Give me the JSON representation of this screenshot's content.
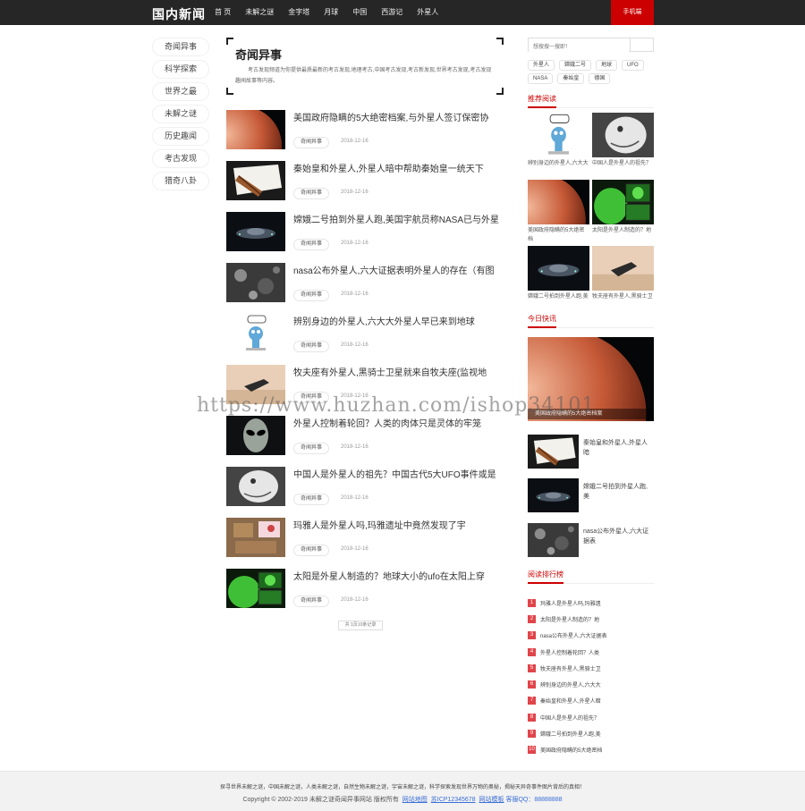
{
  "header": {
    "logo": "国内新闻",
    "nav": [
      "首 页",
      "未解之谜",
      "金字塔",
      "月球",
      "中国",
      "西游记",
      "外星人"
    ],
    "mobile": "手机端"
  },
  "leftnav": [
    "奇闻异事",
    "科学探索",
    "世界之最",
    "未解之谜",
    "历史趣闻",
    "考古发现",
    "猎奇八卦"
  ],
  "intro": {
    "title": "奇闻异事",
    "desc": "考古发现频道为你提供最质最新的考古发现,地理考古,中国考古发现,考古新发现,世界考古发现,考古发现趣闻故事等内容。"
  },
  "articles": [
    {
      "title": "美国政府隐瞒的5大绝密档案,与外星人签订保密协",
      "tag": "奇闻异事",
      "date": "2018-12-16",
      "thumb": "mars"
    },
    {
      "title": "秦始皇和外星人,外星人暗中帮助秦始皇一统天下",
      "tag": "奇闻异事",
      "date": "2018-12-16",
      "thumb": "paper"
    },
    {
      "title": "嫦娥二号拍到外星人跑,美国宇航员称NASA已与外星",
      "tag": "奇闻异事",
      "date": "2018-12-16",
      "thumb": "ship"
    },
    {
      "title": "nasa公布外星人,六大证据表明外星人的存在（有图",
      "tag": "奇闻异事",
      "date": "2018-12-16",
      "thumb": "moon"
    },
    {
      "title": "辨别身边的外星人,六大大外星人早已来到地球",
      "tag": "奇闻异事",
      "date": "2018-12-16",
      "thumb": "cartoon"
    },
    {
      "title": "牧夫座有外星人,黑骑士卫星就来自牧夫座(监视地",
      "tag": "奇闻异事",
      "date": "2018-12-16",
      "thumb": "knight"
    },
    {
      "title": "外星人控制着轮回？人类的肉体只是灵体的牢笼",
      "tag": "奇闻异事",
      "date": "2018-12-16",
      "thumb": "alien"
    },
    {
      "title": "中国人是外星人的祖先？中国古代5大UFO事件或是",
      "tag": "奇闻异事",
      "date": "2018-12-16",
      "thumb": "drawing"
    },
    {
      "title": "玛雅人是外星人吗,玛雅遗址中竟然发现了宇",
      "tag": "奇闻异事",
      "date": "2018-12-16",
      "thumb": "maya"
    },
    {
      "title": "太阳是外星人制造的？地球大小的ufo在太阳上穿",
      "tag": "奇闻异事",
      "date": "2018-12-16",
      "thumb": "sun"
    }
  ],
  "pager": "共 1页10条记录",
  "sidebar": {
    "search_placeholder": "想搜搜一搜即！",
    "keywords": [
      "外星人",
      "嫦娥二号",
      "地球",
      "UFO",
      "NASA",
      "秦始皇",
      "德国"
    ],
    "recommend_title": "推荐阅读",
    "recommend": [
      {
        "cap": "辨别身边的外星人,六大大",
        "thumb": "cartoon"
      },
      {
        "cap": "中国人是外星人的祖先？",
        "thumb": "drawing"
      },
      {
        "cap": "美国政府隐瞒的5大绝密档",
        "thumb": "mars"
      },
      {
        "cap": "太阳是外星人制造的？地",
        "thumb": "sun"
      },
      {
        "cap": "嫦娥二号拍到外星人跑,美",
        "thumb": "ship"
      },
      {
        "cap": "牧夫座有外星人,黑骑士卫",
        "thumb": "knight"
      }
    ],
    "today_title": "今日快讯",
    "today_big_cap": "美国政府隐瞒的5大绝密档案",
    "today": [
      {
        "cap": "秦始皇和外星人,外星人暗",
        "thumb": "paper"
      },
      {
        "cap": "嫦娥二号拍到外星人跑,美",
        "thumb": "ship"
      },
      {
        "cap": "nasa公布外星人,六大证据表",
        "thumb": "moon"
      }
    ],
    "rank_title": "阅读排行榜",
    "rank": [
      {
        "num": "1",
        "text": "玛雅人是外星人吗,玛雅遗"
      },
      {
        "num": "2",
        "text": "太阳是外星人制造的？地"
      },
      {
        "num": "3",
        "text": "nasa公布外星人,六大证据表"
      },
      {
        "num": "4",
        "text": "外星人控制着轮回？人类"
      },
      {
        "num": "5",
        "text": "牧夫座有外星人,黑骑士卫"
      },
      {
        "num": "6",
        "text": "辨别身边的外星人,六大大"
      },
      {
        "num": "7",
        "text": "秦始皇和外星人,外星人暗"
      },
      {
        "num": "8",
        "text": "中国人是外星人的祖先？"
      },
      {
        "num": "9",
        "text": "嫦娥二号拍到外星人跑,美"
      },
      {
        "num": "10",
        "text": "美国政府隐瞒的5大绝密档"
      }
    ]
  },
  "watermark": "https://www.huzhan.com/ishop34101",
  "footer": {
    "line1": "探寻世界未解之谜，中国未解之谜，人类未解之谜，自然生物未解之谜，宇宙未解之谜，科学探索发现世界万物的奥秘，揭秘天异奇事件图片背后的真相！",
    "copyright": "Copyright © 2002-2019 未解之谜奇闻异事网站 版权所有",
    "links": [
      "网站地图",
      "苏ICP12345678",
      "网站模板"
    ],
    "qq": "客服QQ：88888888"
  }
}
